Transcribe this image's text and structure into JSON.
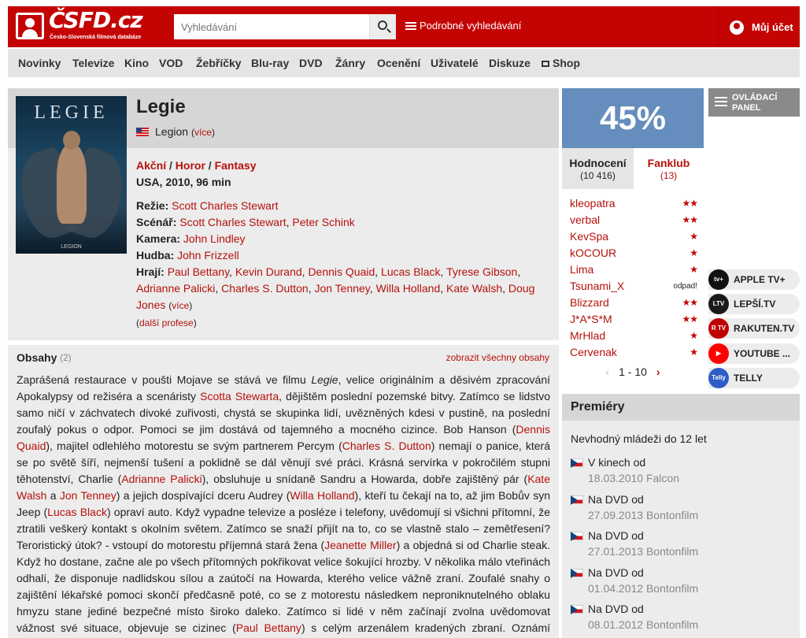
{
  "header": {
    "logo_text": "ČSFD.cz",
    "logo_tagline": "Česko-Slovenská filmová databáze",
    "search_placeholder": "Vyhledávání",
    "advanced_search": "Podrobné vyhledávání",
    "account": "Můj účet"
  },
  "nav": [
    "Novinky",
    "Televize",
    "Kino",
    "VOD",
    "Žebříčky",
    "Blu-ray",
    "DVD",
    "Žánry",
    "Ocenění",
    "Uživatelé",
    "Diskuze",
    "Shop"
  ],
  "film": {
    "poster_title": "LEGIE",
    "poster_subtitle": "LEGION",
    "title": "Legie",
    "original_title": "Legion",
    "more": "více",
    "genres": [
      "Akční",
      "Horor",
      "Fantasy"
    ],
    "origin": "USA, 2010, 96 min",
    "crew": {
      "directing_label": "Režie:",
      "directing": [
        "Scott Charles Stewart"
      ],
      "screenplay_label": "Scénář:",
      "screenplay": [
        "Scott Charles Stewart",
        "Peter Schink"
      ],
      "camera_label": "Kamera:",
      "camera": [
        "John Lindley"
      ],
      "music_label": "Hudba:",
      "music": [
        "John Frizzell"
      ],
      "cast_label": "Hrají:",
      "cast": [
        "Paul Bettany",
        "Kevin Durand",
        "Dennis Quaid",
        "Lucas Black",
        "Tyrese Gibson",
        "Adrianne Palicki",
        "Charles S. Dutton",
        "Jon Tenney",
        "Willa Holland",
        "Kate Walsh",
        "Doug Jones"
      ],
      "cast_more": "více",
      "more_professions": "další profese"
    }
  },
  "plot": {
    "title": "Obsahy",
    "count": "(2)",
    "show_all": "zobrazit všechny obsahy"
  },
  "rating": {
    "percent": "45%",
    "tab_ratings": "Hodnocení",
    "tab_ratings_count": "(10 416)",
    "tab_fanclub": "Fanklub",
    "tab_fanclub_count": "(13)",
    "raters": [
      {
        "name": "kleopatra",
        "stars": 2
      },
      {
        "name": "verbal",
        "stars": 2
      },
      {
        "name": "KevSpa",
        "stars": 1
      },
      {
        "name": "kOCOUR",
        "stars": 1
      },
      {
        "name": "Lima",
        "stars": 1
      },
      {
        "name": "Tsunami_X",
        "stars": 0,
        "text": "odpad!"
      },
      {
        "name": "Blizzard",
        "stars": 2
      },
      {
        "name": "J*A*S*M",
        "stars": 2
      },
      {
        "name": "MrHlad",
        "stars": 1
      },
      {
        "name": "Cervenak",
        "stars": 1
      }
    ],
    "pager": "1 - 10"
  },
  "control_panel": "OVLÁDACÍ PANEL",
  "vod": [
    {
      "name": "APPLE TV+",
      "logo": "tv+",
      "color": "#111111"
    },
    {
      "name": "LEPŠÍ.TV",
      "logo": "LTV",
      "color": "#1a1a1a"
    },
    {
      "name": "RAKUTEN.TV",
      "logo": "R TV",
      "color": "#bf0000"
    },
    {
      "name": "YOUTUBE ...",
      "logo": "▶",
      "color": "#ff0000"
    },
    {
      "name": "TELLY",
      "logo": "Telly",
      "color": "#2e5cc8"
    }
  ],
  "premieres": {
    "title": "Premiéry",
    "age": "Nevhodný mládeži do 12 let",
    "items": [
      {
        "type": "V kinech od",
        "date": "18.03.2010 Falcon"
      },
      {
        "type": "Na DVD od",
        "date": "27.09.2013 Bontonfilm"
      },
      {
        "type": "Na DVD od",
        "date": "27.01.2013 Bontonfilm"
      },
      {
        "type": "Na DVD od",
        "date": "01.04.2012 Bontonfilm"
      },
      {
        "type": "Na DVD od",
        "date": "08.01.2012 Bontonfilm"
      }
    ]
  },
  "plot_text": [
    "Zaprášená restaurace v poušti Mojave se stává ve filmu ",
    "Legie",
    ", velice originálním a děsivém zpracování Apokalypsy od režiséra a scenáristy ",
    "Scotta Stewarta",
    ", dějištěm poslední pozemské bitvy. Zatímco se lidstvo samo ničí v záchvatech divoké zuřivosti, chystá se skupinka lidí, uvězněných kdesi v pustině, na poslední zoufalý pokus o odpor. Pomoci se jim dostává od tajemného a mocného cizince. Bob Hanson (",
    "Dennis Quaid",
    "), majitel odlehlého motorestu se svým partnerem Percym (",
    "Charles S. Dutton",
    ") nemají o panice, která se po světě šíří, nejmenší tušení a poklidně se dál věnují své práci. Krásná servírka v pokročilém stupni těhotenství, Charlie (",
    "Adrianne Palicki",
    "), obsluhuje u snídaně Sandru a Howarda, dobře zajištěný pár (",
    "Kate Walsh",
    " a ",
    "Jon Tenney",
    ") a jejich dospívající dceru Audrey (",
    "Willa Holland",
    "), kteří tu čekají na to, až jim Bobův syn Jeep (",
    "Lucas Black",
    ") opraví auto. Když vypadne televize a posléze i telefony, uvědomují si všichni přítomní, že ztratili veškerý kontakt s okolním světem. Zatímco se snaží přijít na to, co se vlastně stalo – zemětřesení? Teroristický útok? - vstoupí do motorestu příjemná stará žena (",
    "Jeanette Miller",
    ") a objedná si od Charlie steak. Když ho dostane, začne ale po všech přítomných pokřikovat velice šokující hrozby. V několika málo vteřinách odhalí, že disponuje nadlidskou sílou a zaútočí na Howarda, kterého velice vážně zraní. Zoufalé snahy o zajištění lékařské pomoci skončí předčasně poté, co se z motorestu následkem neproniknutelného oblaku hmyzu stane jediné bezpečné místo široko daleko. Zatímco si lidé v něm začínají zvolna uvědomovat vážnost své situace, objevuje se cizinec (",
    "Paul Bettany",
    ") s celým arzenálem kradených zbraní. Oznámí Charlie, že její"
  ]
}
